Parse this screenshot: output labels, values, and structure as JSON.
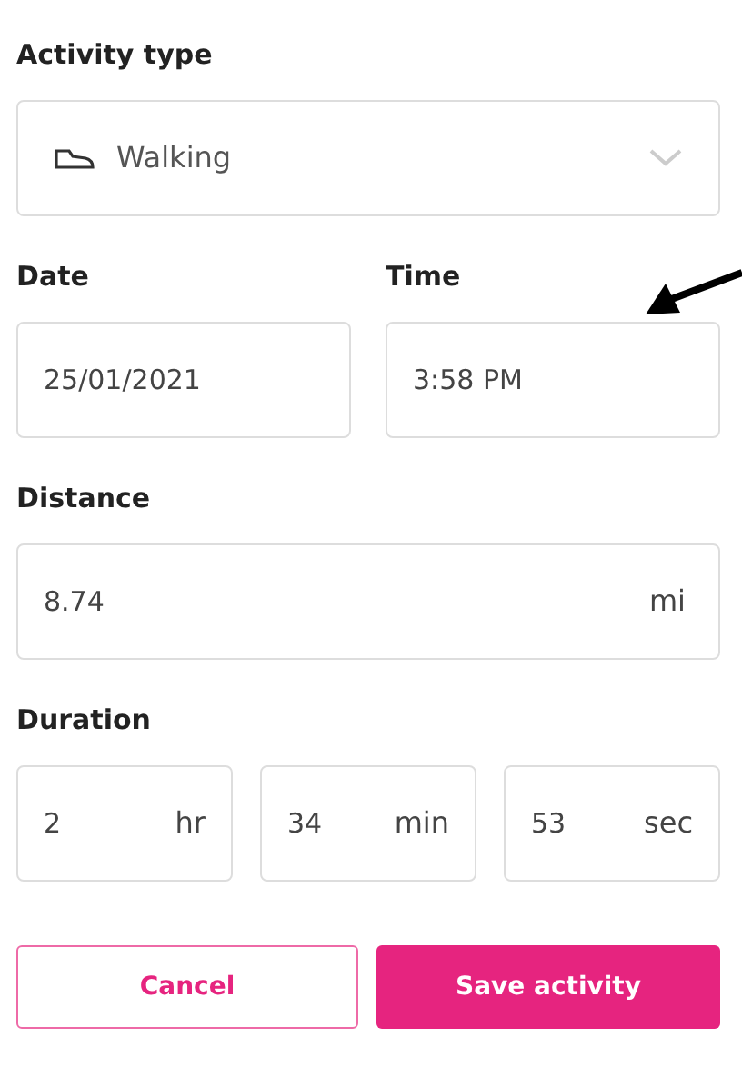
{
  "activity_type": {
    "label": "Activity type",
    "value": "Walking"
  },
  "date": {
    "label": "Date",
    "value": "25/01/2021"
  },
  "time": {
    "label": "Time",
    "value": "3:58 PM"
  },
  "distance": {
    "label": "Distance",
    "value": "8.74",
    "unit": "mi"
  },
  "duration": {
    "label": "Duration",
    "fields": [
      {
        "value": "2",
        "unit": "hr"
      },
      {
        "value": "34",
        "unit": "min"
      },
      {
        "value": "53",
        "unit": "sec"
      }
    ]
  },
  "buttons": [
    {
      "label": "Cancel",
      "kind": "secondary"
    },
    {
      "label": "Save activity",
      "kind": "primary"
    }
  ]
}
